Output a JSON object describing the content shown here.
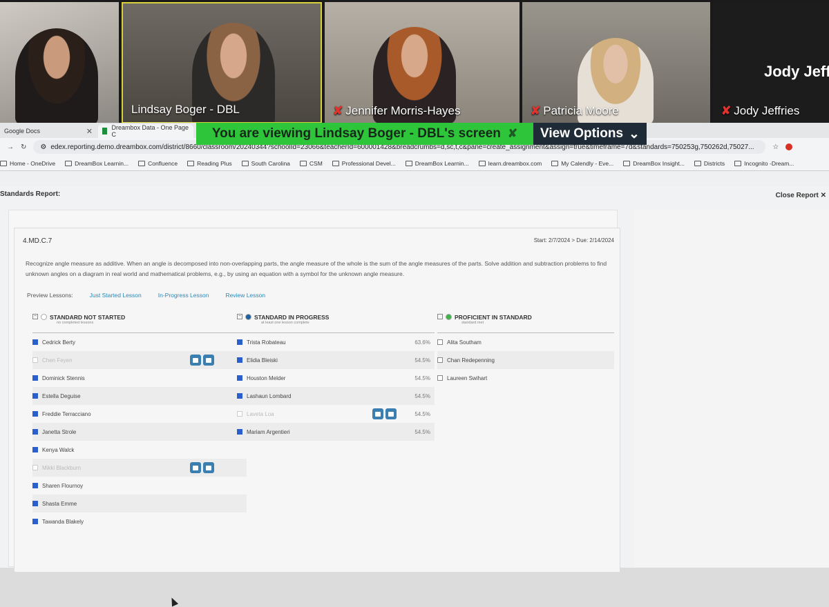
{
  "zoom": {
    "participants": [
      {
        "name": "",
        "muted": false
      },
      {
        "name": "Lindsay Boger - DBL",
        "muted": false
      },
      {
        "name": "Jennifer Morris-Hayes",
        "muted": true
      },
      {
        "name": "Patricia Moore",
        "muted": true
      },
      {
        "name": "Jody Jeffries",
        "muted": true,
        "large_name": "Jody Jeffr"
      }
    ],
    "share_banner": "You are viewing  Lindsay Boger - DBL's screen",
    "view_options": "View Options"
  },
  "browser": {
    "tabs": [
      {
        "label": "Google Docs"
      },
      {
        "label": "Dreambox Data - One Page C"
      }
    ],
    "url": "edex.reporting.demo.dreambox.com/district/8660/classroom/20240344?schoolId=23066&teacherId=600001428&breadcrumbs=d,sc,t,c&pane=create_assignment&assign=true&timeframe=7d&standards=750253g,750262d,75027...",
    "bookmarks": [
      "Home - OneDrive",
      "DreamBox Learnin...",
      "Confluence",
      "Reading Plus",
      "South Carolina",
      "CSM",
      "Professional Devel...",
      "DreamBox Learnin...",
      "learn.dreambox.com",
      "My Calendly - Eve...",
      "DreamBox Insight...",
      "Districts",
      "Incognito -Dream..."
    ]
  },
  "report": {
    "title": "Standards Report:",
    "close_label": "Close Report",
    "standard_code": "4.MD.C.7",
    "dates": "Start: 2/7/2024  >  Due: 2/14/2024",
    "description": "Recognize angle measure as additive. When an angle is decomposed into non-overlapping parts, the angle measure of the whole is the sum of the angle measures of the parts. Solve addition and subtraction problems to find unknown angles on a diagram in real world and mathematical problems, e.g., by using an equation with a symbol for the unknown angle measure.",
    "preview_label": "Preview Lessons:",
    "preview_links": [
      "Just Started Lesson",
      "In-Progress Lesson",
      "Review Lesson"
    ],
    "columns": [
      {
        "title": "STANDARD NOT STARTED",
        "subtitle": "no completed lessons",
        "dot_color": "#ffffff",
        "students": [
          {
            "name": "Cedrick Berty",
            "checked": true,
            "faded": false,
            "calendar": false
          },
          {
            "name": "Chen Feyen",
            "checked": false,
            "faded": true,
            "calendar": true
          },
          {
            "name": "Dominick Stennis",
            "checked": true,
            "faded": false,
            "calendar": false
          },
          {
            "name": "Estella Deguise",
            "checked": true,
            "faded": false,
            "calendar": false
          },
          {
            "name": "Freddie Terracciano",
            "checked": true,
            "faded": false,
            "calendar": false
          },
          {
            "name": "Janetta Strole",
            "checked": true,
            "faded": false,
            "calendar": false
          },
          {
            "name": "Kenya Walck",
            "checked": true,
            "faded": false,
            "calendar": false
          },
          {
            "name": "Mikki Blackburn",
            "checked": false,
            "faded": true,
            "calendar": true
          },
          {
            "name": "Sharen Flournoy",
            "checked": true,
            "faded": false,
            "calendar": false
          },
          {
            "name": "Shasta Emme",
            "checked": true,
            "faded": false,
            "calendar": false
          },
          {
            "name": "Tawanda Blakely",
            "checked": true,
            "faded": false,
            "calendar": false
          }
        ]
      },
      {
        "title": "STANDARD IN PROGRESS",
        "subtitle": "at least one lesson complete",
        "dot_color": "#1f5f9a",
        "students": [
          {
            "name": "Trista Robateau",
            "checked": true,
            "faded": false,
            "calendar": false,
            "pct": "63.6%"
          },
          {
            "name": "Elidia Bleiski",
            "checked": true,
            "faded": false,
            "calendar": false,
            "pct": "54.5%"
          },
          {
            "name": "Houston Melder",
            "checked": true,
            "faded": false,
            "calendar": false,
            "pct": "54.5%"
          },
          {
            "name": "Lashaun Lombard",
            "checked": true,
            "faded": false,
            "calendar": false,
            "pct": "54.5%"
          },
          {
            "name": "Laveta Loa",
            "checked": false,
            "faded": true,
            "calendar": true,
            "pct": "54.5%"
          },
          {
            "name": "Mariam Argentieri",
            "checked": true,
            "faded": false,
            "calendar": false,
            "pct": "54.5%"
          }
        ]
      },
      {
        "title": "PROFICIENT IN STANDARD",
        "subtitle": "standard met",
        "dot_color": "#3fb24a",
        "students": [
          {
            "name": "Alita Southam",
            "checked": false,
            "faded": false,
            "calendar": false
          },
          {
            "name": "Chan Redepenning",
            "checked": false,
            "faded": false,
            "calendar": false
          },
          {
            "name": "Laureen Swihart",
            "checked": false,
            "faded": false,
            "calendar": false
          }
        ]
      }
    ]
  }
}
